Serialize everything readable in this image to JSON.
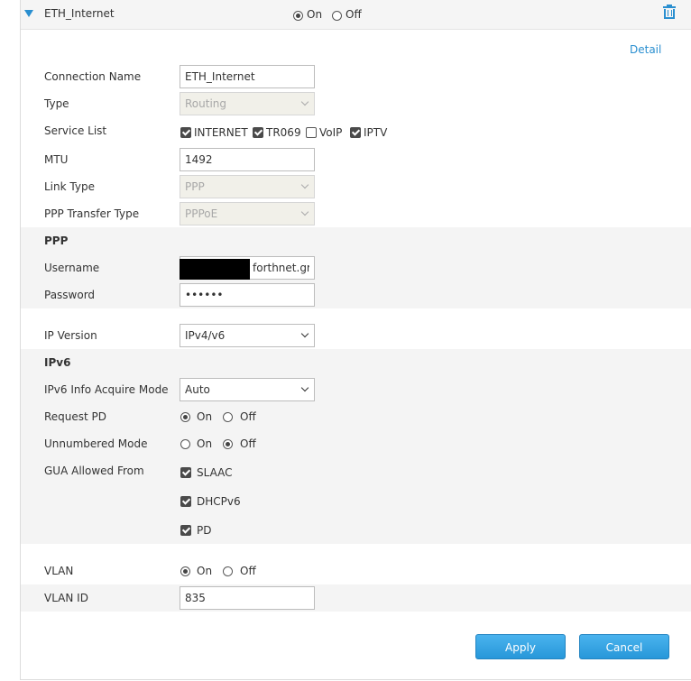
{
  "header": {
    "title": "ETH_Internet",
    "on_label": "On",
    "off_label": "Off",
    "selected": "on"
  },
  "detail_link": "Detail",
  "form": {
    "connection_name": {
      "label": "Connection Name",
      "value": "ETH_Internet"
    },
    "type": {
      "label": "Type",
      "value": "Routing"
    },
    "service_list": {
      "label": "Service List",
      "items": [
        {
          "label": "INTERNET",
          "checked": true
        },
        {
          "label": "TR069",
          "checked": true
        },
        {
          "label": "VoIP",
          "checked": false
        },
        {
          "label": "IPTV",
          "checked": true
        }
      ]
    },
    "mtu": {
      "label": "MTU",
      "value": "1492"
    },
    "link_type": {
      "label": "Link Type",
      "value": "PPP"
    },
    "ppp_transfer_type": {
      "label": "PPP Transfer Type",
      "value": "PPPoE"
    }
  },
  "ppp": {
    "section_title": "PPP",
    "username": {
      "label": "Username",
      "value": "forthnet.gr"
    },
    "password": {
      "label": "Password",
      "value": "••••••"
    }
  },
  "ip_version": {
    "label": "IP Version",
    "value": "IPv4/v6"
  },
  "ipv6": {
    "section_title": "IPv6",
    "acquire_mode": {
      "label": "IPv6 Info Acquire Mode",
      "value": "Auto"
    },
    "request_pd": {
      "label": "Request PD",
      "on_label": "On",
      "off_label": "Off",
      "selected": "on"
    },
    "unnumbered_mode": {
      "label": "Unnumbered Mode",
      "on_label": "On",
      "off_label": "Off",
      "selected": "off"
    },
    "gua_allowed_from": {
      "label": "GUA Allowed From",
      "items": [
        {
          "label": "SLAAC",
          "checked": true
        },
        {
          "label": "DHCPv6",
          "checked": true
        },
        {
          "label": "PD",
          "checked": true
        }
      ]
    }
  },
  "vlan": {
    "vlan": {
      "label": "VLAN",
      "on_label": "On",
      "off_label": "Off",
      "selected": "on"
    },
    "vlan_id": {
      "label": "VLAN ID",
      "value": "835"
    }
  },
  "buttons": {
    "apply": "Apply",
    "cancel": "Cancel"
  },
  "colors": {
    "accent": "#2a8fd0",
    "button": "#2797d9",
    "band": "#f4f4f4"
  }
}
